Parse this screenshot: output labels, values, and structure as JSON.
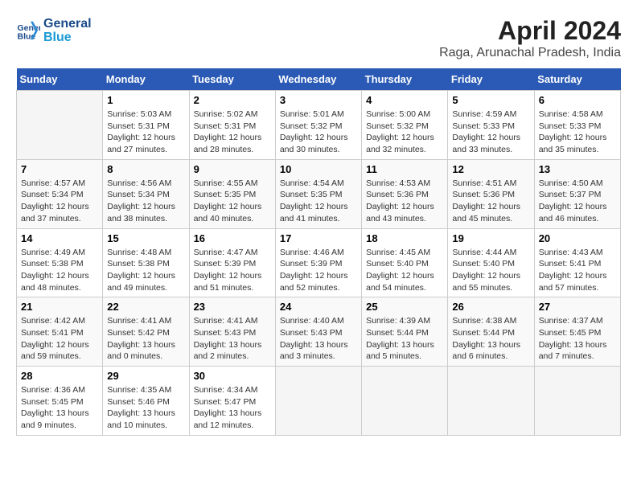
{
  "logo": {
    "text_general": "General",
    "text_blue": "Blue"
  },
  "title": "April 2024",
  "subtitle": "Raga, Arunachal Pradesh, India",
  "days_header": [
    "Sunday",
    "Monday",
    "Tuesday",
    "Wednesday",
    "Thursday",
    "Friday",
    "Saturday"
  ],
  "weeks": [
    [
      {
        "day": "",
        "info": ""
      },
      {
        "day": "1",
        "info": "Sunrise: 5:03 AM\nSunset: 5:31 PM\nDaylight: 12 hours\nand 27 minutes."
      },
      {
        "day": "2",
        "info": "Sunrise: 5:02 AM\nSunset: 5:31 PM\nDaylight: 12 hours\nand 28 minutes."
      },
      {
        "day": "3",
        "info": "Sunrise: 5:01 AM\nSunset: 5:32 PM\nDaylight: 12 hours\nand 30 minutes."
      },
      {
        "day": "4",
        "info": "Sunrise: 5:00 AM\nSunset: 5:32 PM\nDaylight: 12 hours\nand 32 minutes."
      },
      {
        "day": "5",
        "info": "Sunrise: 4:59 AM\nSunset: 5:33 PM\nDaylight: 12 hours\nand 33 minutes."
      },
      {
        "day": "6",
        "info": "Sunrise: 4:58 AM\nSunset: 5:33 PM\nDaylight: 12 hours\nand 35 minutes."
      }
    ],
    [
      {
        "day": "7",
        "info": "Sunrise: 4:57 AM\nSunset: 5:34 PM\nDaylight: 12 hours\nand 37 minutes."
      },
      {
        "day": "8",
        "info": "Sunrise: 4:56 AM\nSunset: 5:34 PM\nDaylight: 12 hours\nand 38 minutes."
      },
      {
        "day": "9",
        "info": "Sunrise: 4:55 AM\nSunset: 5:35 PM\nDaylight: 12 hours\nand 40 minutes."
      },
      {
        "day": "10",
        "info": "Sunrise: 4:54 AM\nSunset: 5:35 PM\nDaylight: 12 hours\nand 41 minutes."
      },
      {
        "day": "11",
        "info": "Sunrise: 4:53 AM\nSunset: 5:36 PM\nDaylight: 12 hours\nand 43 minutes."
      },
      {
        "day": "12",
        "info": "Sunrise: 4:51 AM\nSunset: 5:36 PM\nDaylight: 12 hours\nand 45 minutes."
      },
      {
        "day": "13",
        "info": "Sunrise: 4:50 AM\nSunset: 5:37 PM\nDaylight: 12 hours\nand 46 minutes."
      }
    ],
    [
      {
        "day": "14",
        "info": "Sunrise: 4:49 AM\nSunset: 5:38 PM\nDaylight: 12 hours\nand 48 minutes."
      },
      {
        "day": "15",
        "info": "Sunrise: 4:48 AM\nSunset: 5:38 PM\nDaylight: 12 hours\nand 49 minutes."
      },
      {
        "day": "16",
        "info": "Sunrise: 4:47 AM\nSunset: 5:39 PM\nDaylight: 12 hours\nand 51 minutes."
      },
      {
        "day": "17",
        "info": "Sunrise: 4:46 AM\nSunset: 5:39 PM\nDaylight: 12 hours\nand 52 minutes."
      },
      {
        "day": "18",
        "info": "Sunrise: 4:45 AM\nSunset: 5:40 PM\nDaylight: 12 hours\nand 54 minutes."
      },
      {
        "day": "19",
        "info": "Sunrise: 4:44 AM\nSunset: 5:40 PM\nDaylight: 12 hours\nand 55 minutes."
      },
      {
        "day": "20",
        "info": "Sunrise: 4:43 AM\nSunset: 5:41 PM\nDaylight: 12 hours\nand 57 minutes."
      }
    ],
    [
      {
        "day": "21",
        "info": "Sunrise: 4:42 AM\nSunset: 5:41 PM\nDaylight: 12 hours\nand 59 minutes."
      },
      {
        "day": "22",
        "info": "Sunrise: 4:41 AM\nSunset: 5:42 PM\nDaylight: 13 hours\nand 0 minutes."
      },
      {
        "day": "23",
        "info": "Sunrise: 4:41 AM\nSunset: 5:43 PM\nDaylight: 13 hours\nand 2 minutes."
      },
      {
        "day": "24",
        "info": "Sunrise: 4:40 AM\nSunset: 5:43 PM\nDaylight: 13 hours\nand 3 minutes."
      },
      {
        "day": "25",
        "info": "Sunrise: 4:39 AM\nSunset: 5:44 PM\nDaylight: 13 hours\nand 5 minutes."
      },
      {
        "day": "26",
        "info": "Sunrise: 4:38 AM\nSunset: 5:44 PM\nDaylight: 13 hours\nand 6 minutes."
      },
      {
        "day": "27",
        "info": "Sunrise: 4:37 AM\nSunset: 5:45 PM\nDaylight: 13 hours\nand 7 minutes."
      }
    ],
    [
      {
        "day": "28",
        "info": "Sunrise: 4:36 AM\nSunset: 5:45 PM\nDaylight: 13 hours\nand 9 minutes."
      },
      {
        "day": "29",
        "info": "Sunrise: 4:35 AM\nSunset: 5:46 PM\nDaylight: 13 hours\nand 10 minutes."
      },
      {
        "day": "30",
        "info": "Sunrise: 4:34 AM\nSunset: 5:47 PM\nDaylight: 13 hours\nand 12 minutes."
      },
      {
        "day": "",
        "info": ""
      },
      {
        "day": "",
        "info": ""
      },
      {
        "day": "",
        "info": ""
      },
      {
        "day": "",
        "info": ""
      }
    ]
  ]
}
